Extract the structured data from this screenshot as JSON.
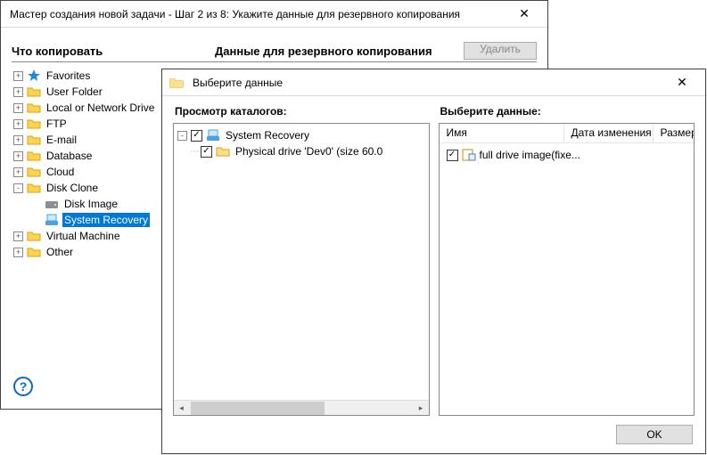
{
  "main": {
    "title": "Мастер создания новой задачи - Шаг 2 из 8: Укажите данные для резервного копирования",
    "what_to_copy": "Что копировать",
    "backup_data": "Данные для резервного копирования",
    "delete_label": "Удалить",
    "help_glyph": "?",
    "tree_items": [
      {
        "expand": "+",
        "icon": "star",
        "label": "Favorites",
        "indent": 0
      },
      {
        "expand": "+",
        "icon": "folder",
        "label": "User Folder",
        "indent": 0
      },
      {
        "expand": "+",
        "icon": "folder",
        "label": "Local or Network Drive",
        "indent": 0
      },
      {
        "expand": "+",
        "icon": "folder",
        "label": "FTP",
        "indent": 0
      },
      {
        "expand": "+",
        "icon": "folder",
        "label": "E-mail",
        "indent": 0
      },
      {
        "expand": "+",
        "icon": "folder",
        "label": "Database",
        "indent": 0
      },
      {
        "expand": "+",
        "icon": "folder",
        "label": "Cloud",
        "indent": 0
      },
      {
        "expand": "-",
        "icon": "folder",
        "label": "Disk Clone",
        "indent": 0
      },
      {
        "expand": "",
        "icon": "disk",
        "label": "Disk Image",
        "indent": 1
      },
      {
        "expand": "",
        "icon": "recovery",
        "label": "System Recovery",
        "indent": 1,
        "selected": true
      },
      {
        "expand": "+",
        "icon": "folder",
        "label": "Virtual Machine",
        "indent": 0
      },
      {
        "expand": "+",
        "icon": "folder",
        "label": "Other",
        "indent": 0
      }
    ]
  },
  "dlg": {
    "title": "Выберите данные",
    "left_title": "Просмотр каталогов:",
    "right_title": "Выберите данные:",
    "col_name": "Имя",
    "col_date": "Дата изменения",
    "col_size": "Размер",
    "catalog": {
      "root": {
        "expand": "-",
        "label": "System Recovery"
      },
      "child": {
        "label": "Physical drive 'Dev0' (size 60.0"
      }
    },
    "file_row": {
      "label": "full drive image(fixe..."
    },
    "ok_label": "OK"
  },
  "icons": {
    "close": "✕",
    "left": "◂",
    "right": "▸"
  }
}
